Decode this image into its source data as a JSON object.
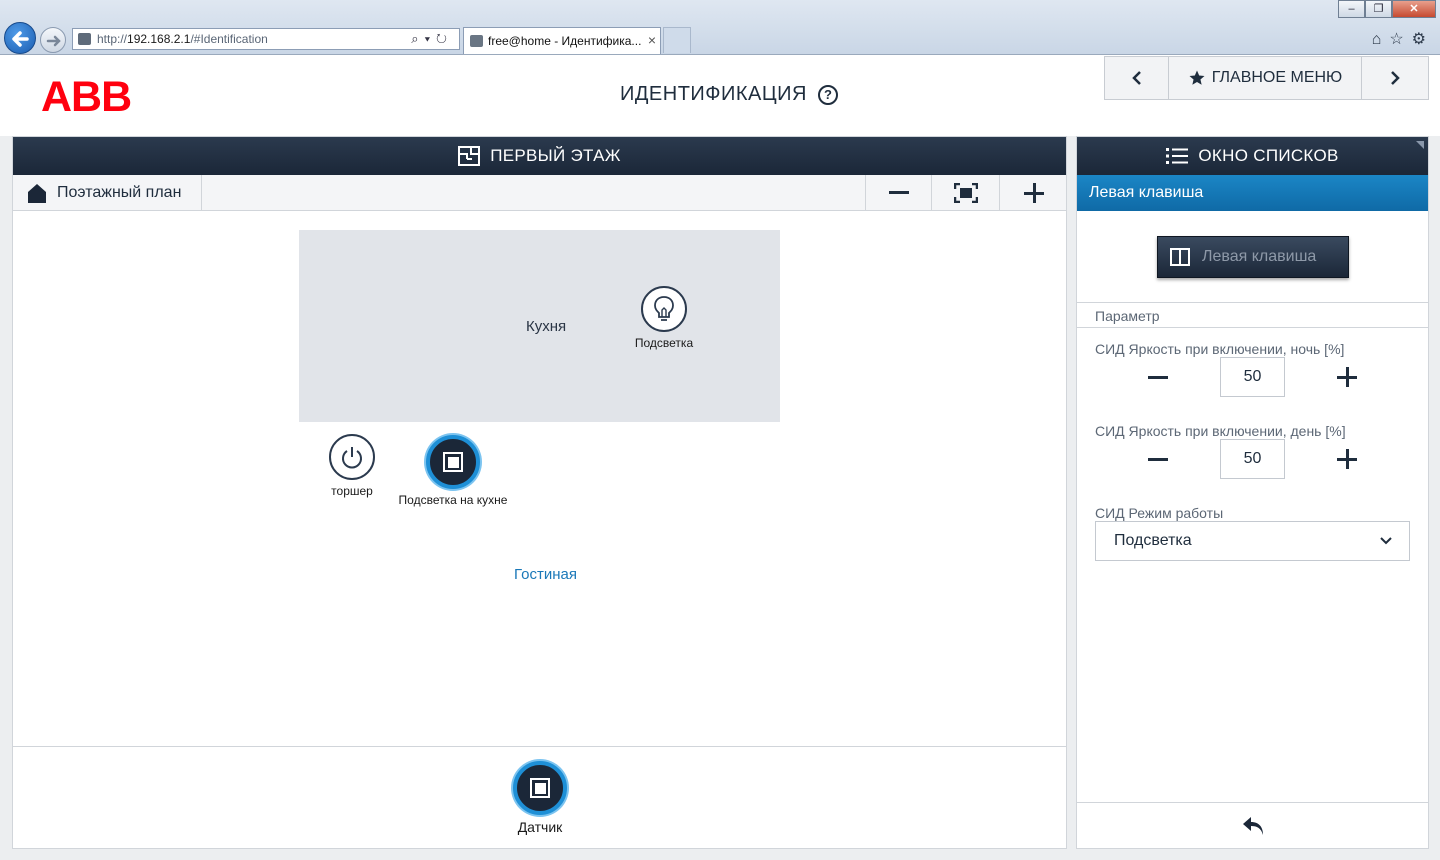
{
  "browser": {
    "url_prefix": "http://",
    "url_host": "192.168.2.1",
    "url_path": "/#Identification",
    "tab_title": "free@home - Идентифика...",
    "tab_close": "×"
  },
  "header": {
    "logo": "ABB",
    "title": "ИДЕНТИФИКАЦИЯ",
    "help": "?",
    "nav_prev": "‹",
    "nav_main": "ГЛАВНОЕ МЕНЮ",
    "nav_next": "›"
  },
  "floor": {
    "title": "ПЕРВЫЙ ЭТАЖ",
    "plan_label": "Поэтажный план",
    "rooms": {
      "kitchen": "Кухня",
      "living": "Гостиная"
    },
    "devices": {
      "kitchen_light": "Подсветка",
      "floor_lamp": "торшер",
      "kitchen_sensor": "Подсветка на кухне"
    },
    "tray_device": "Датчик"
  },
  "list_window": {
    "title": "ОКНО СПИСКОВ",
    "selected": "Левая клавиша",
    "key_button": "Левая клавиша",
    "param_header": "Параметр",
    "params": [
      {
        "label": "СИД Яркость при включении, ночь [%]",
        "value": "50"
      },
      {
        "label": "СИД Яркость при включении, день [%]",
        "value": "50"
      }
    ],
    "mode_label": "СИД Режим работы",
    "mode_value": "Подсветка"
  },
  "colors": {
    "abb_red": "#ff000f",
    "header_dark": "#1b2738",
    "accent_blue": "#1b86c6"
  }
}
